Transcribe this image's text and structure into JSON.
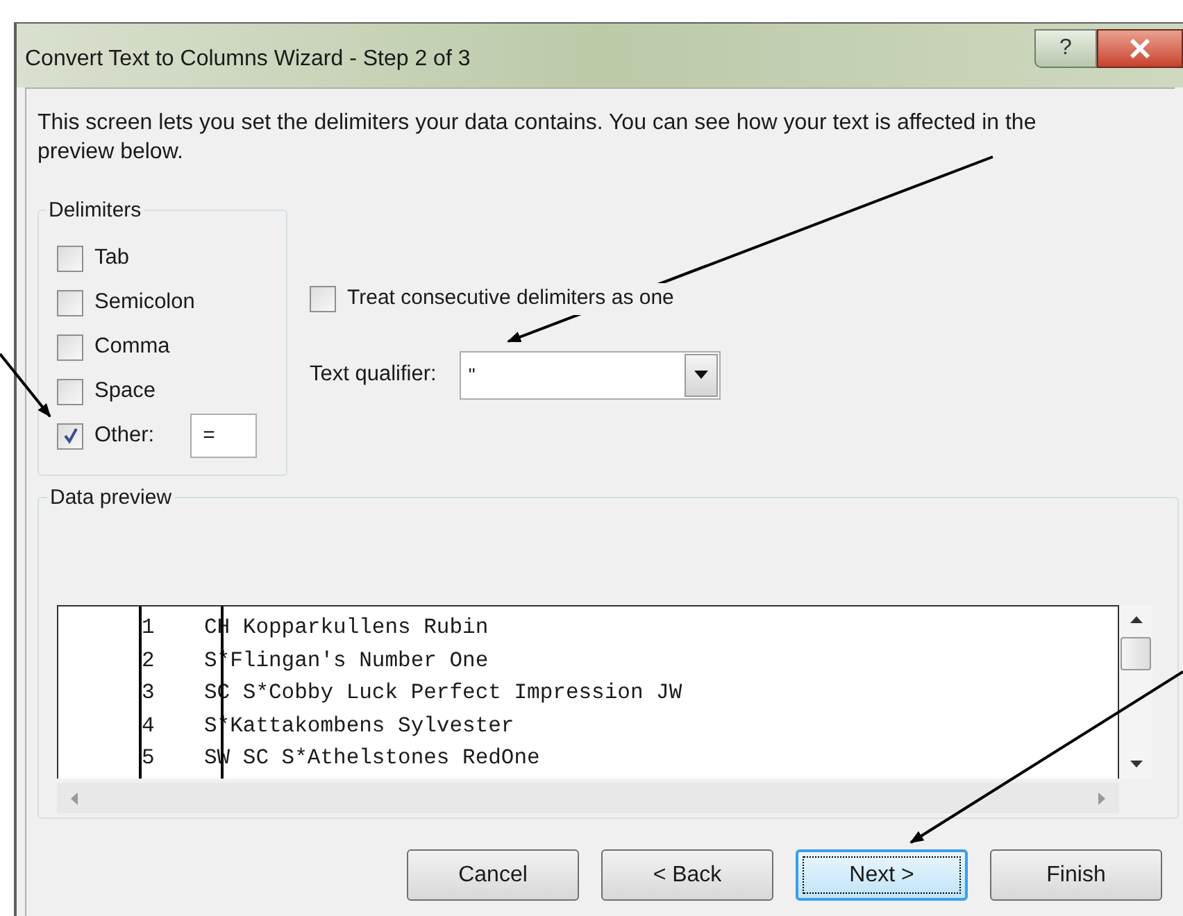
{
  "window": {
    "title": "Convert Text to Columns Wizard - Step 2 of 3",
    "help_button": "?"
  },
  "description": "This screen lets you set the delimiters your data contains.  You can see how your text is affected in the preview below.",
  "delimiters": {
    "title": "Delimiters",
    "options": [
      {
        "label": "Tab",
        "checked": false
      },
      {
        "label": "Semicolon",
        "checked": false
      },
      {
        "label": "Comma",
        "checked": false
      },
      {
        "label": "Space",
        "checked": false
      },
      {
        "label": "Other:",
        "checked": true,
        "value": "="
      }
    ]
  },
  "consecutive": {
    "label": "Treat consecutive delimiters as one",
    "checked": false
  },
  "text_qualifier": {
    "label": "Text qualifier:",
    "value": "\""
  },
  "data_preview": {
    "title": "Data preview",
    "rows": [
      {
        "cells": [
          "1",
          "CH Kopparkullens Rubin"
        ]
      },
      {
        "cells": [
          "2",
          "S*Flingan's Number One"
        ]
      },
      {
        "cells": [
          "3",
          "SC S*Cobby Luck Perfect Impression JW"
        ]
      },
      {
        "cells": [
          "4",
          "S*Kattakombens Sylvester"
        ]
      },
      {
        "cells": [
          "5",
          "SW SC S*Athelstones RedOne"
        ]
      }
    ]
  },
  "buttons": [
    {
      "label": "Cancel",
      "focused": false
    },
    {
      "label": "< Back",
      "focused": false
    },
    {
      "label": "Next >",
      "focused": true
    },
    {
      "label": "Finish",
      "focused": false
    }
  ]
}
